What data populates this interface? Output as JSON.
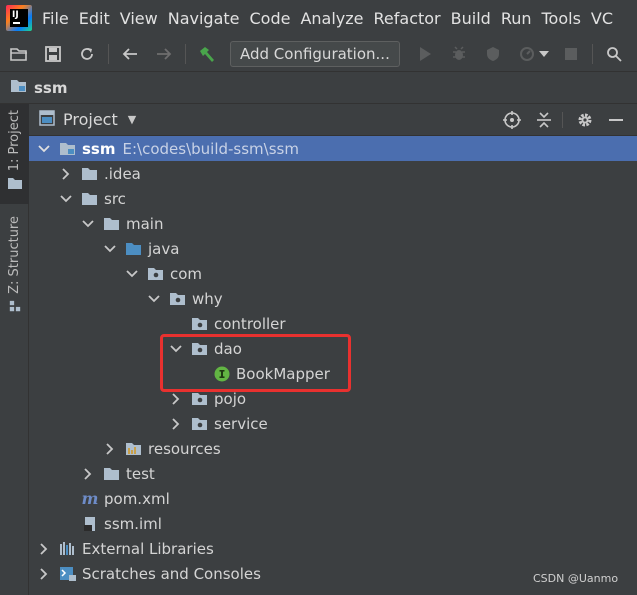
{
  "menu": [
    "File",
    "Edit",
    "View",
    "Navigate",
    "Code",
    "Analyze",
    "Refactor",
    "Build",
    "Run",
    "Tools",
    "VC"
  ],
  "toolbar": {
    "add_configuration": "Add Configuration...",
    "icons": [
      "open-folder-icon",
      "save-icon",
      "sync-icon",
      "back-arrow-icon",
      "forward-arrow-icon",
      "build-hammer-icon",
      "run-icon",
      "debug-icon",
      "coverage-icon",
      "profile-icon",
      "stop-icon",
      "search-everywhere-icon"
    ]
  },
  "navbar": {
    "project": "ssm"
  },
  "side_tabs": {
    "project": "1: Project",
    "structure": "Z: Structure"
  },
  "panel": {
    "title": "Project"
  },
  "tree": [
    {
      "label": "ssm",
      "path": "E:\\codes\\build-ssm\\ssm",
      "icon": "module-folder-icon",
      "expanded": true,
      "selected": true
    },
    {
      "label": ".idea",
      "icon": "folder-icon",
      "expanded": false
    },
    {
      "label": "src",
      "icon": "folder-icon",
      "expanded": true
    },
    {
      "label": "main",
      "icon": "folder-icon",
      "expanded": true
    },
    {
      "label": "java",
      "icon": "source-folder-icon",
      "expanded": true
    },
    {
      "label": "com",
      "icon": "package-icon",
      "expanded": true
    },
    {
      "label": "why",
      "icon": "package-icon",
      "expanded": true
    },
    {
      "label": "controller",
      "icon": "package-icon"
    },
    {
      "label": "dao",
      "icon": "package-icon",
      "expanded": true
    },
    {
      "label": "BookMapper",
      "icon": "interface-icon"
    },
    {
      "label": "pojo",
      "icon": "package-icon",
      "expanded": false
    },
    {
      "label": "service",
      "icon": "package-icon",
      "expanded": false
    },
    {
      "label": "resources",
      "icon": "resources-folder-icon",
      "expanded": false
    },
    {
      "label": "test",
      "icon": "folder-icon",
      "expanded": false
    },
    {
      "label": "pom.xml",
      "icon": "maven-icon"
    },
    {
      "label": "ssm.iml",
      "icon": "iml-file-icon"
    },
    {
      "label": "External Libraries",
      "icon": "libraries-icon",
      "expanded": false
    },
    {
      "label": "Scratches and Consoles",
      "icon": "scratches-icon",
      "expanded": false
    }
  ],
  "watermark": "CSDN @Uanmo",
  "colors": {
    "selection": "#4b6eaf",
    "highlight_box": "#e8312f",
    "background": "#3c3f41"
  }
}
